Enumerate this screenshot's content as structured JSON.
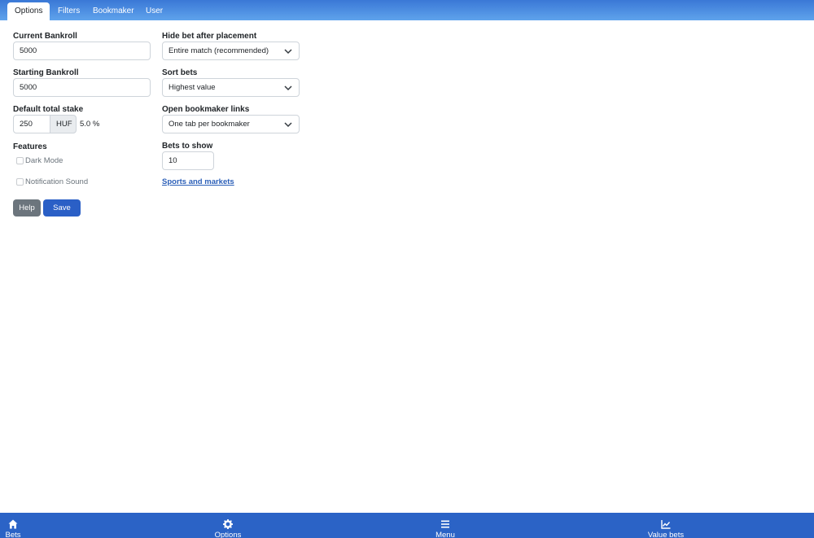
{
  "tabs": [
    "Options",
    "Filters",
    "Bookmaker",
    "User"
  ],
  "current_bankroll": {
    "label": "Current Bankroll",
    "value": "5000"
  },
  "starting_bankroll": {
    "label": "Starting Bankroll",
    "value": "5000"
  },
  "default_stake": {
    "label": "Default total stake",
    "value": "250",
    "currency": "HUF",
    "percent": "5.0 %"
  },
  "features": {
    "label": "Features",
    "dark_mode": "Dark Mode",
    "notification_sound": "Notification Sound"
  },
  "hide_bet": {
    "label": "Hide bet after placement",
    "value": "Entire match (recommended)"
  },
  "sort_bets": {
    "label": "Sort bets",
    "value": "Highest value"
  },
  "open_links": {
    "label": "Open bookmaker links",
    "value": "One tab per bookmaker"
  },
  "bets_to_show": {
    "label": "Bets to show",
    "value": "10"
  },
  "sports_link": "Sports and markets",
  "buttons": {
    "help": "Help",
    "save": "Save"
  },
  "bottom_nav": {
    "bets": {
      "label": "Bets",
      "icon": "home-icon"
    },
    "options": {
      "label": "Options",
      "icon": "gear-icon"
    },
    "menu": {
      "label": "Menu",
      "icon": "hamburger-icon"
    },
    "value_bets": {
      "label": "Value bets",
      "icon": "chart-line-icon"
    }
  },
  "colors": {
    "topbar": "#4a8ee2",
    "bottombar": "#2b63c6",
    "save_button": "#2a5fc6",
    "help_button": "#6c757d",
    "link": "#2b5fb8"
  }
}
